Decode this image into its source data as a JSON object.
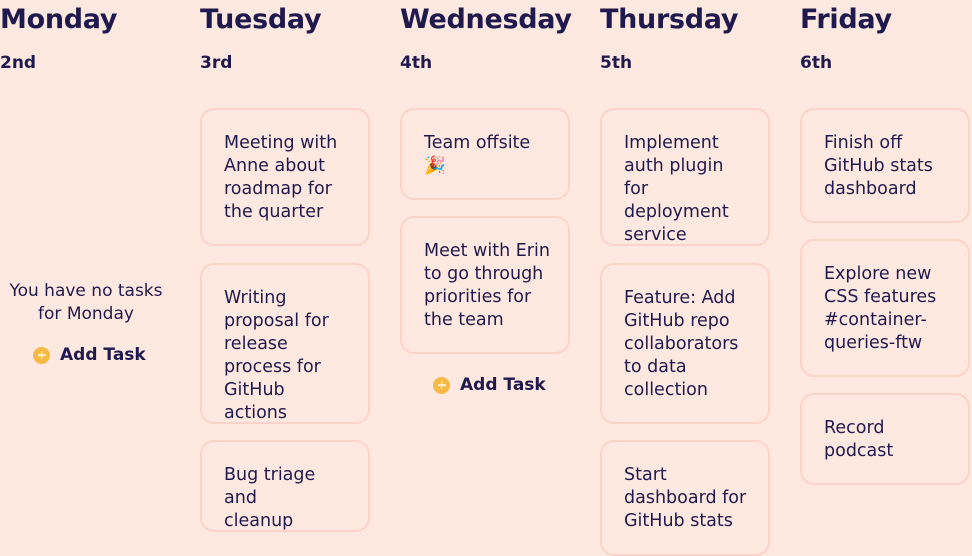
{
  "colors": {
    "background": "#ffe8e0",
    "text": "#1f1a4d",
    "card_border": "#fbd3c8",
    "add_icon": "#f7b945"
  },
  "days": {
    "monday": {
      "name": "Monday",
      "date": "2nd",
      "empty_message": "You have no tasks for Monday",
      "add_task_label": "Add Task"
    },
    "tuesday": {
      "name": "Tuesday",
      "date": "3rd",
      "tasks": [
        "Meeting with\nAnne about\nroadmap for\nthe quarter",
        "Writing\nproposal for\nrelease\nprocess for\nGitHub actions",
        "Bug triage and\ncleanup"
      ]
    },
    "wednesday": {
      "name": "Wednesday",
      "date": "4th",
      "tasks": [
        "Team offsite\n🎉",
        "Meet with Erin\nto go through\npriorities for\nthe team"
      ],
      "add_task_label": "Add Task"
    },
    "thursday": {
      "name": "Thursday",
      "date": "5th",
      "tasks": [
        "Implement\nauth plugin for\ndeployment\nservice",
        "Feature: Add\nGitHub repo\ncollaborators\nto data\ncollection",
        "Start\ndashboard for\nGitHub stats"
      ]
    },
    "friday": {
      "name": "Friday",
      "date": "6th",
      "tasks": [
        "Finish off\nGitHub stats\ndashboard",
        "Explore new\nCSS features\n#container-\nqueries-ftw",
        "Record\npodcast"
      ]
    }
  }
}
